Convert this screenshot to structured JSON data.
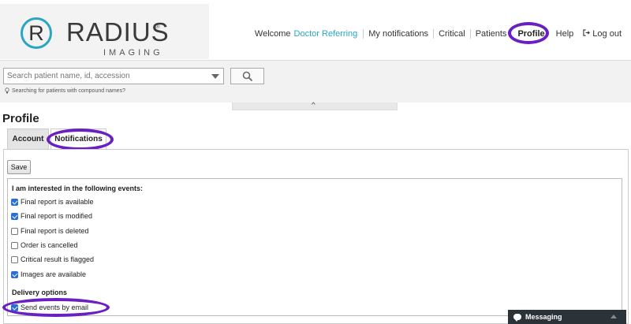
{
  "brand": {
    "logo_letter": "R",
    "name": "RADIUS",
    "registered": "®",
    "subtitle": "IMAGING",
    "accent_color": "#2aa6c4"
  },
  "topnav": {
    "welcome": "Welcome",
    "user_name": "Doctor Referring",
    "my_notifications": "My notifications",
    "critical": "Critical",
    "patients": "Patients",
    "profile": "Profile",
    "help": "Help",
    "logout": "Log out",
    "logout_icon": "logout-icon"
  },
  "search": {
    "placeholder": "Search patient name, id, accession",
    "hint": "Searching for patients with compound names?",
    "button_icon": "search-icon",
    "hint_icon": "bulb-icon"
  },
  "collapse": {
    "icon": "chevron-up-icon",
    "glyph": "^"
  },
  "page": {
    "title": "Profile",
    "tabs": [
      {
        "label": "Account",
        "active": false
      },
      {
        "label": "Notifications",
        "active": true
      }
    ],
    "save_label": "Save"
  },
  "events": {
    "heading": "I am interested in the following events:",
    "items": [
      {
        "label": "Final report is available",
        "checked": true
      },
      {
        "label": "Final report is modified",
        "checked": true
      },
      {
        "label": "Final report is deleted",
        "checked": false
      },
      {
        "label": "Order is cancelled",
        "checked": false
      },
      {
        "label": "Critical result is flagged",
        "checked": false
      },
      {
        "label": "Images are available",
        "checked": true
      }
    ]
  },
  "delivery": {
    "heading": "Delivery options",
    "items": [
      {
        "label": "Send events by email",
        "checked": true
      }
    ]
  },
  "messaging": {
    "label": "Messaging",
    "icon": "chat-icon"
  },
  "annotation_color": "#6a1fc2"
}
